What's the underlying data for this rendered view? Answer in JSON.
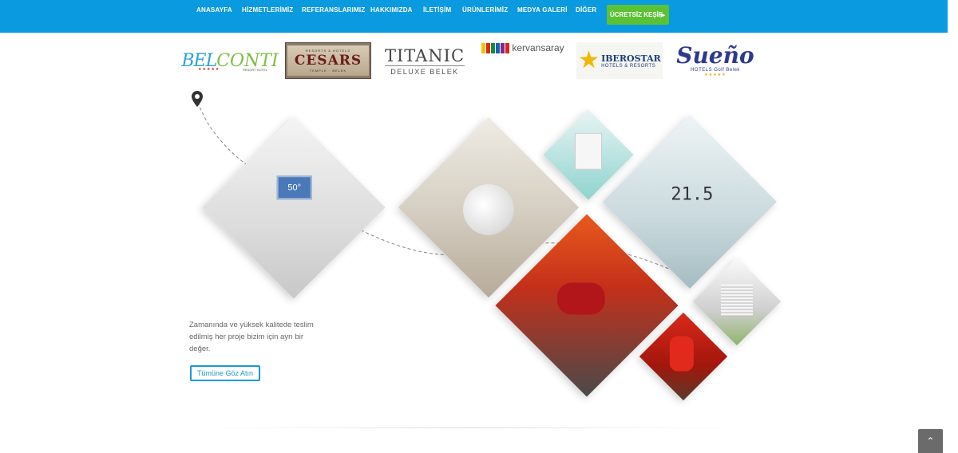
{
  "nav": {
    "items": [
      {
        "label": "ANASAYFA"
      },
      {
        "label": "HİZMETLERİMİZ"
      },
      {
        "label": "REFERANSLARIMIZ"
      },
      {
        "label": "HAKKIMIZDA"
      },
      {
        "label": "İLETİŞİM"
      },
      {
        "label": "ÜRÜNLERİMİZ"
      },
      {
        "label": "MEDYA GALERİ"
      },
      {
        "label": "DİĞER"
      }
    ],
    "cta_label": "ÜCRETSİZ KEŞİF",
    "background_color": "#0a9ae0",
    "cta_color": "#5bc236"
  },
  "references": {
    "belconti": {
      "part1": "BEL",
      "part2": "CONTI",
      "stars": "★★★★★",
      "subtitle": "RESORT HOTEL"
    },
    "cesars": {
      "top": "RESORTS & HOTELS",
      "name": "CESARS",
      "tag": "TEMPLE · BELEK"
    },
    "titanic": {
      "name": "TITANIC",
      "tag": "DELUXE BELEK"
    },
    "kervansaray": {
      "name": "kervansaray"
    },
    "iberostar": {
      "name": "IBEROSTAR",
      "tag": "HOTELS & RESORTS"
    },
    "sueno": {
      "name": "Sueño",
      "tag": "HOTELS Golf Belek",
      "stars": "★★★★★"
    }
  },
  "collage": {
    "boiler_display": "50°",
    "thermostat_display": "21.5"
  },
  "intro": {
    "description": "Zamanında ve yüksek kalitede teslim edilmiş her proje bizim için ayrı bir değer.",
    "button_label": "Tümüne Göz Atın"
  },
  "back_to_top_icon": "chevron-up-icon"
}
